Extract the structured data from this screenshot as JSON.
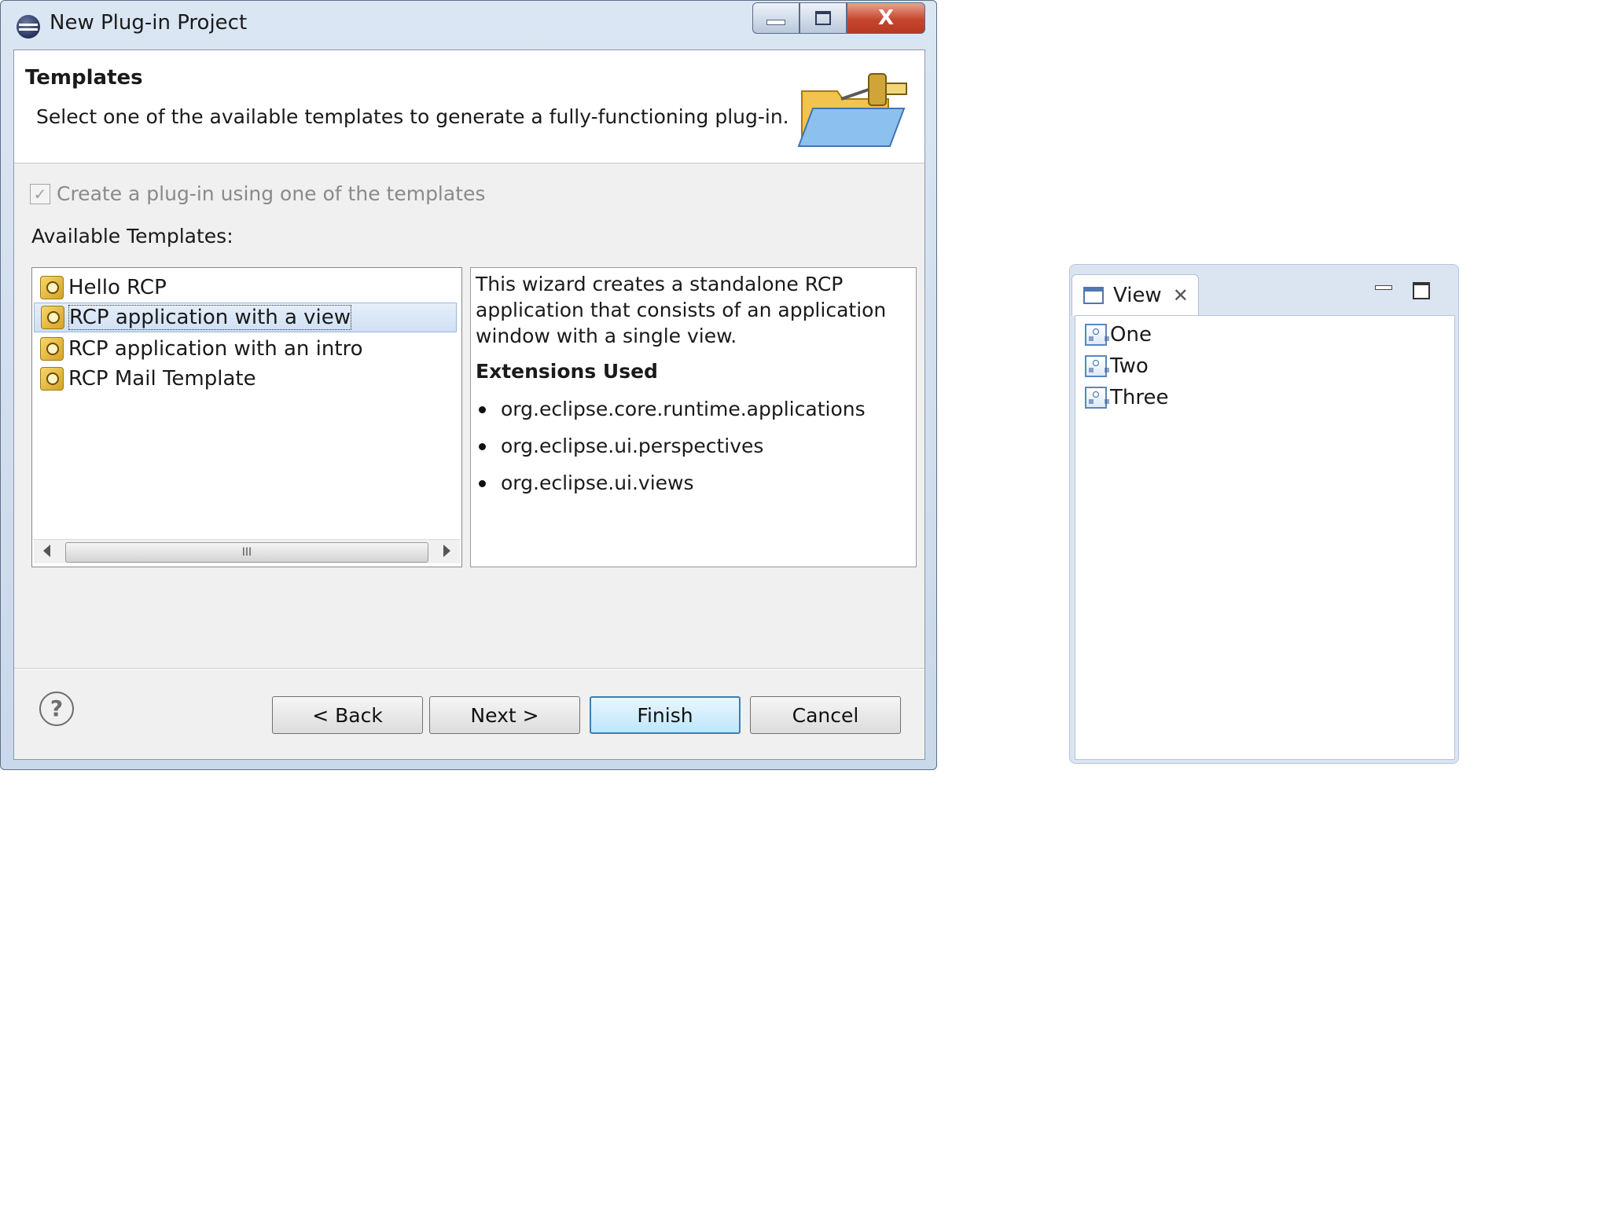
{
  "dialog": {
    "title": "New Plug-in Project",
    "window_buttons": {
      "close": "X"
    },
    "header": {
      "title": "Templates",
      "description": "Select one of the available templates to generate a fully-functioning plug-in."
    },
    "checkbox_label": "Create a plug-in using one of the templates",
    "checkbox_checked": true,
    "available_label": "Available Templates:",
    "templates": [
      {
        "label": "Hello RCP",
        "selected": false
      },
      {
        "label": "RCP application with a view",
        "selected": true
      },
      {
        "label": "RCP application with an intro",
        "selected": false
      },
      {
        "label": "RCP Mail Template",
        "selected": false
      }
    ],
    "scroll_thumb": "III",
    "description_panel": {
      "text": "This wizard creates a standalone RCP application that consists of an application window with a single view.",
      "extensions_heading": "Extensions Used",
      "extensions": [
        "org.eclipse.core.runtime.applications",
        "org.eclipse.ui.perspectives",
        "org.eclipse.ui.views"
      ]
    },
    "help_glyph": "?",
    "buttons": {
      "back": "< Back",
      "next": "Next >",
      "finish": "Finish",
      "cancel": "Cancel"
    }
  },
  "view_part": {
    "tab_label": "View",
    "items": [
      "One",
      "Two",
      "Three"
    ]
  }
}
